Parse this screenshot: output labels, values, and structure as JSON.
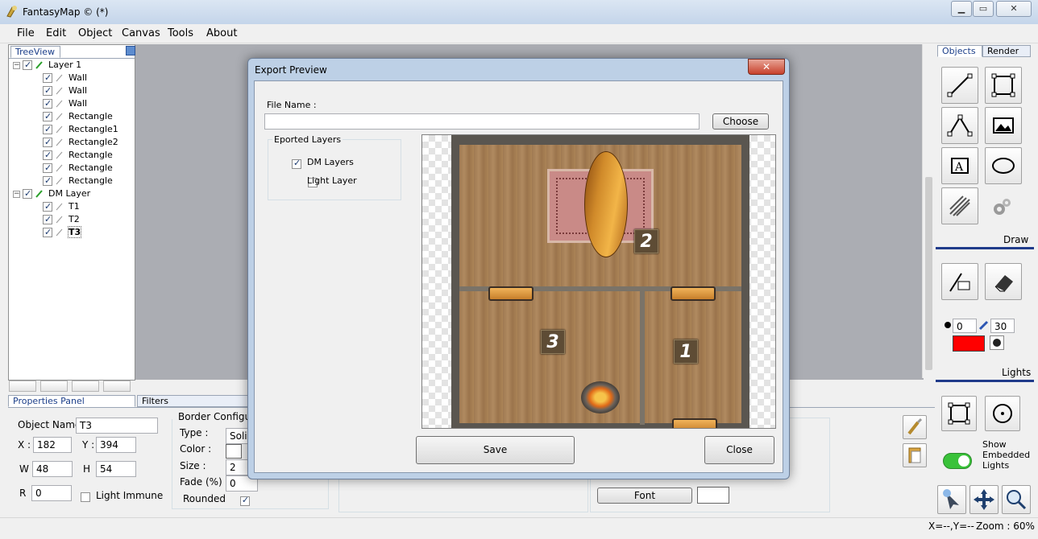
{
  "app": {
    "title": "FantasyMap © (*)"
  },
  "menu": [
    "File",
    "Edit",
    "Object",
    "Canvas",
    "Tools",
    "About"
  ],
  "treeview": {
    "tab_label": "TreeView",
    "layers": [
      {
        "name": "Layer 1",
        "items": [
          "Wall",
          "Wall",
          "Wall",
          "Rectangle",
          "Rectangle1",
          "Rectangle2",
          "Rectangle",
          "Rectangle",
          "Rectangle"
        ]
      },
      {
        "name": "DM Layer",
        "items": [
          "T1",
          "T2",
          "T3"
        ]
      }
    ]
  },
  "props": {
    "tab_properties": "Properties Panel",
    "tab_filters": "Filters",
    "object_name_label": "Object Name",
    "object_name": "T3",
    "x_label": "X :",
    "x": "182",
    "y_label": "Y :",
    "y": "394",
    "w_label": "W",
    "w": "48",
    "h_label": "H",
    "h": "54",
    "r_label": "R",
    "r": "0",
    "light_immune": "Light Immune",
    "border_title": "Border Configuratio",
    "type_label": "Type :",
    "type_value": "Solid",
    "color_label": "Color :",
    "size_label": "Size :",
    "size_value": "2",
    "fade_label": "Fade (%) :",
    "fade_value": "0",
    "rounded_label": "Rounded",
    "font_button": "Font"
  },
  "right_panel": {
    "tab_objects": "Objects",
    "tab_render": "Render",
    "draw_label": "Draw",
    "lights_label": "Lights",
    "light_small": "0",
    "light_size": "30",
    "light_color": "#ff0000",
    "show_embedded": "Show Embedded Lights"
  },
  "status": {
    "coords": "X=--,Y=--",
    "zoom": "Zoom : 60%"
  },
  "dialog": {
    "title": "Export Preview",
    "file_name_label": "File Name :",
    "file_name_value": "",
    "choose_button": "Choose",
    "exported_layers_title": "Eported Layers",
    "layers": [
      {
        "label": "DM Layers",
        "checked": true
      },
      {
        "label": "Light Layer",
        "checked": false
      }
    ],
    "markers": [
      "2",
      "3",
      "1"
    ],
    "save_button": "Save",
    "close_button": "Close",
    "close_icon": "close-icon"
  }
}
